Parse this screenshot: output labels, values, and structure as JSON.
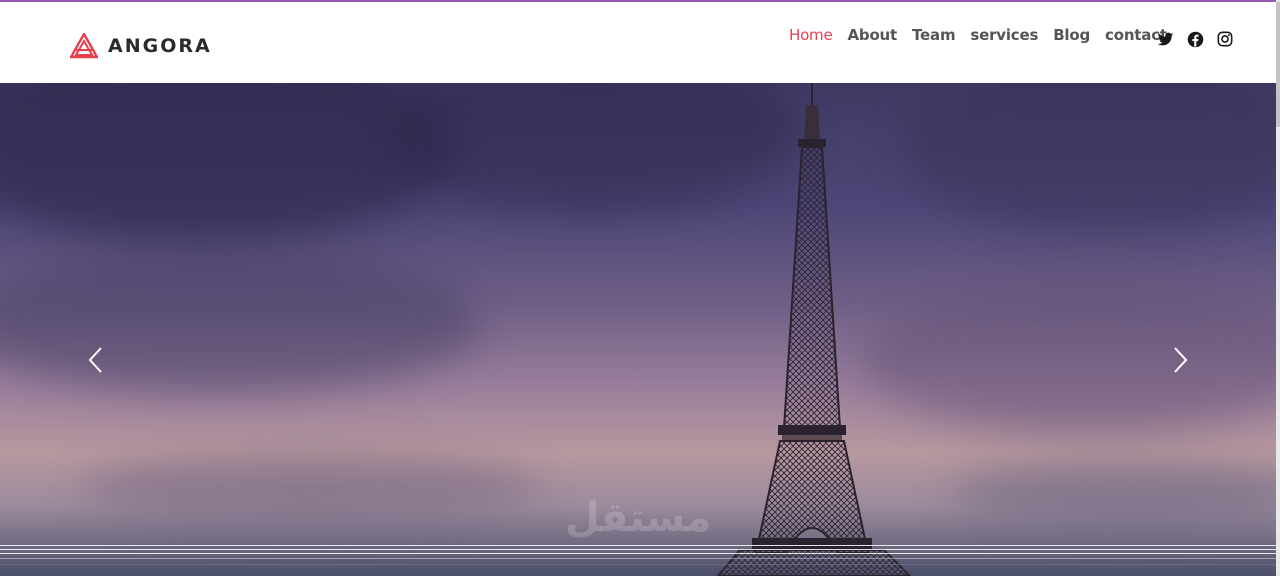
{
  "brand": {
    "name": "ANGORA",
    "logo_icon": "angora-logo-icon",
    "accent_color": "#e8404f"
  },
  "nav": {
    "items": [
      {
        "label": "Home",
        "active": true
      },
      {
        "label": "About"
      },
      {
        "label": "Team"
      },
      {
        "label": "services"
      },
      {
        "label": "Blog"
      },
      {
        "label": "contact"
      }
    ]
  },
  "social": {
    "icons": [
      "twitter-icon",
      "facebook-icon",
      "instagram-icon"
    ]
  },
  "hero": {
    "image": "eiffel-tower-at-dusk",
    "prev_icon": "chevron-left-icon",
    "next_icon": "chevron-right-icon",
    "watermark": "مستقل"
  }
}
